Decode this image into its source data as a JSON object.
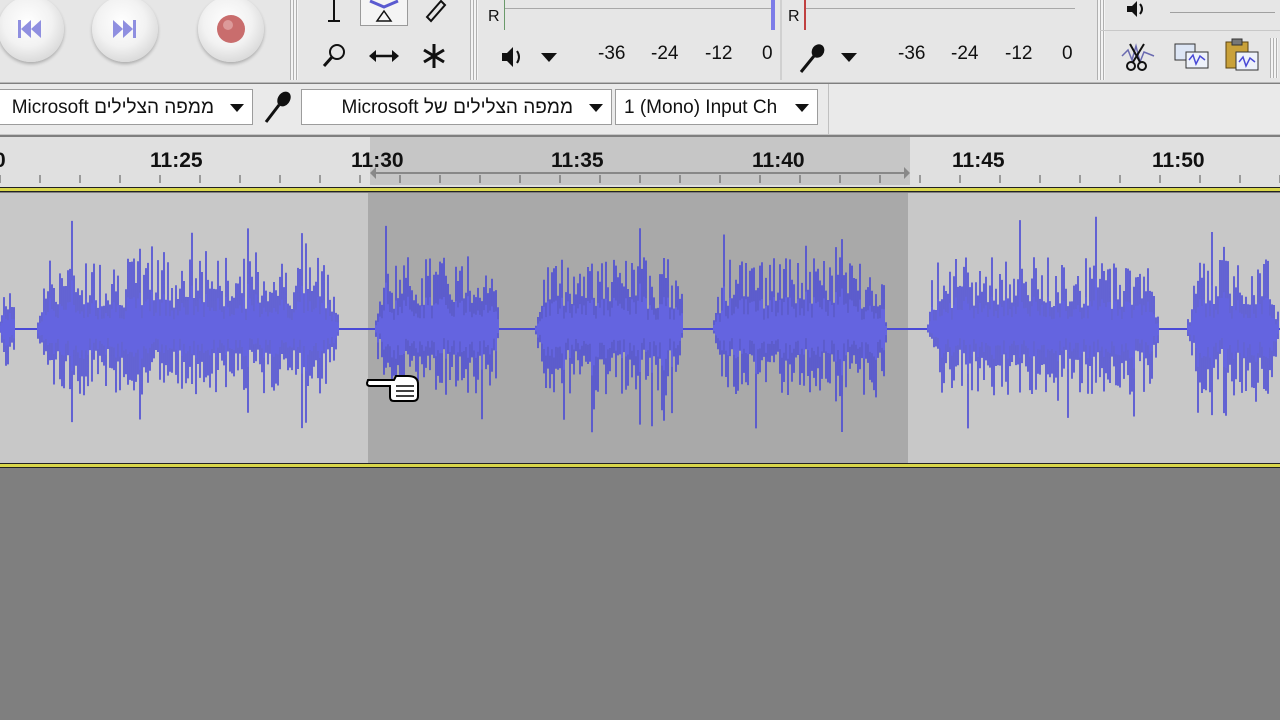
{
  "meters": {
    "playback_channel": "R",
    "record_channel": "R",
    "playback_scale": [
      "-36",
      "-24",
      "-12",
      "0"
    ],
    "record_scale": [
      "-36",
      "-24",
      "-12",
      "0"
    ]
  },
  "devices": {
    "playback_device": "Microsoft ממפה הצלילים",
    "recording_device": "Microsoft ממפה הצלילים של",
    "input_channels": "1 (Mono) Input Ch"
  },
  "timeline": {
    "left_partial": "0",
    "labels": [
      "11:25",
      "11:30",
      "11:35",
      "11:40",
      "11:45",
      "11:50"
    ]
  },
  "colors": {
    "waveform": "#4a4ad6",
    "selection": "#a9a9a9",
    "track_bg": "#c8c8c8",
    "empty_area": "#7f7f7f",
    "track_border": "#d9d64a"
  },
  "icons": {
    "skip_start": "skip-to-start-icon",
    "skip_end": "skip-to-end-icon",
    "record": "record-icon",
    "selection_tool": "i-beam-icon",
    "envelope_tool": "envelope-icon",
    "draw_tool": "pencil-icon",
    "zoom_tool": "magnifier-icon",
    "timeshift_tool": "timeshift-icon",
    "multi_tool": "multi-tool-icon"
  }
}
